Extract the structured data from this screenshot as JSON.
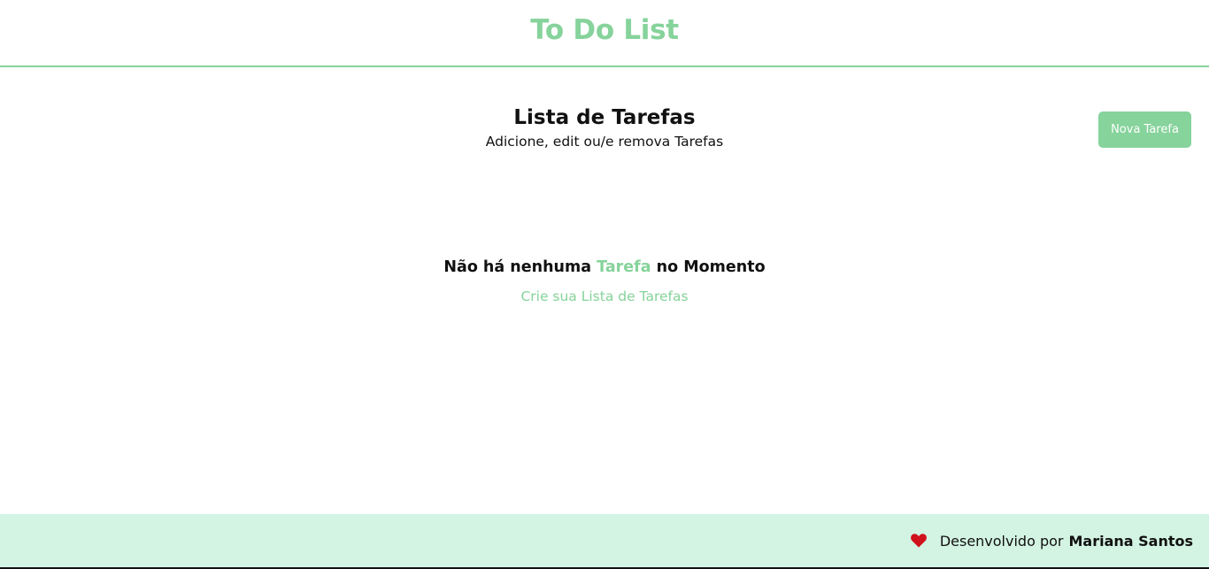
{
  "colors": {
    "accent": "#86d39b",
    "footer_bg": "#d3f3e3",
    "heart": "#d0121c"
  },
  "header": {
    "title": "To Do List"
  },
  "list_heading": {
    "title": "Lista de Tarefas",
    "subtitle": "Adicione, edit ou/e remova Tarefas"
  },
  "toolbar": {
    "new_task_label": "Nova Tarefa"
  },
  "empty_state": {
    "title_prefix": "Não há nenhuma",
    "title_accent": "Tarefa",
    "title_suffix": "no Momento",
    "cta_label": "Crie sua Lista de Tarefas"
  },
  "footer": {
    "icon": "heart-icon",
    "text": "Desenvolvido por",
    "author": "Mariana Santos"
  }
}
